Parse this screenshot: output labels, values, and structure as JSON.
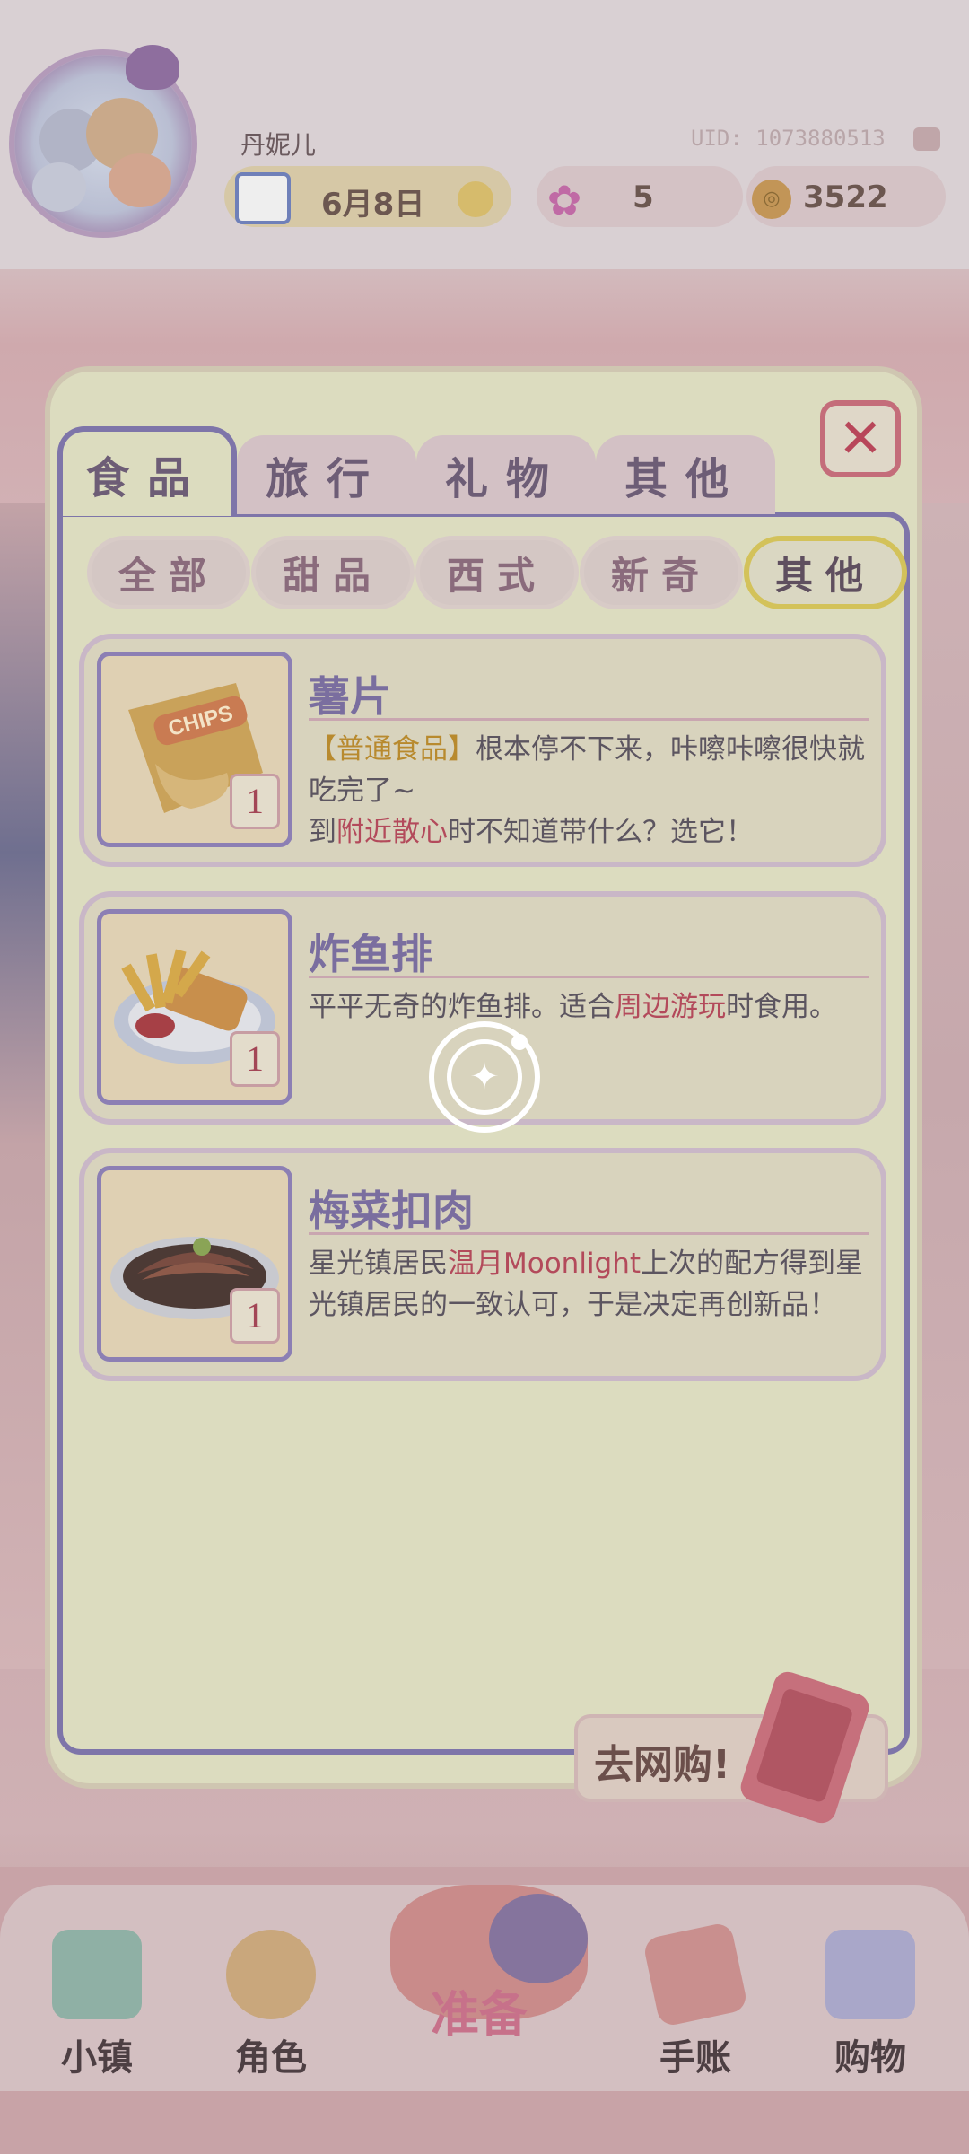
{
  "header": {
    "username": "丹妮儿",
    "uid": "UID: 1073880513",
    "date": "6月8日",
    "stars": "5",
    "coins": "3522"
  },
  "tabs": [
    {
      "label": "食品",
      "active": true
    },
    {
      "label": "旅行",
      "active": false
    },
    {
      "label": "礼物",
      "active": false
    },
    {
      "label": "其他",
      "active": false
    }
  ],
  "filters": [
    {
      "label": "全部",
      "active": false
    },
    {
      "label": "甜品",
      "active": false
    },
    {
      "label": "西式",
      "active": false
    },
    {
      "label": "新奇",
      "active": false
    },
    {
      "label": "其他",
      "active": true
    }
  ],
  "items": [
    {
      "name": "薯片",
      "qty": "1",
      "desc": [
        {
          "text": "【普通食品】",
          "style": "orange"
        },
        {
          "text": "根本停不下来，咔嚓咔嚓很快就吃完了~",
          "style": "plain"
        },
        {
          "text": "到",
          "style": "plain"
        },
        {
          "text": "附近散心",
          "style": "red"
        },
        {
          "text": "时不知道带什么？选它！",
          "style": "plain"
        }
      ]
    },
    {
      "name": "炸鱼排",
      "qty": "1",
      "desc": [
        {
          "text": "平平无奇的炸鱼排。适合",
          "style": "plain"
        },
        {
          "text": "周边游玩",
          "style": "red"
        },
        {
          "text": "时食用。",
          "style": "plain"
        }
      ]
    },
    {
      "name": "梅菜扣肉",
      "qty": "1",
      "desc": [
        {
          "text": "星光镇居民",
          "style": "plain"
        },
        {
          "text": "温月Moonlight",
          "style": "red"
        },
        {
          "text": "上次的配方得到星光镇居民的一致认可，于是决定再创新品！",
          "style": "plain"
        }
      ]
    }
  ],
  "chips_text": "CHIPS",
  "shop_button": "去网购!",
  "nav": [
    {
      "label": "小镇",
      "icon": "map-icon"
    },
    {
      "label": "角色",
      "icon": "character-icon"
    },
    {
      "label": "准备",
      "icon": "basket-icon"
    },
    {
      "label": "手账",
      "icon": "journal-icon"
    },
    {
      "label": "购物",
      "icon": "shopping-bag-icon"
    }
  ],
  "colors": {
    "tab_border": "#7e75a9",
    "highlight_red": "#b34a5b",
    "highlight_orange": "#b88a2e",
    "close_red": "#c46d7a"
  }
}
